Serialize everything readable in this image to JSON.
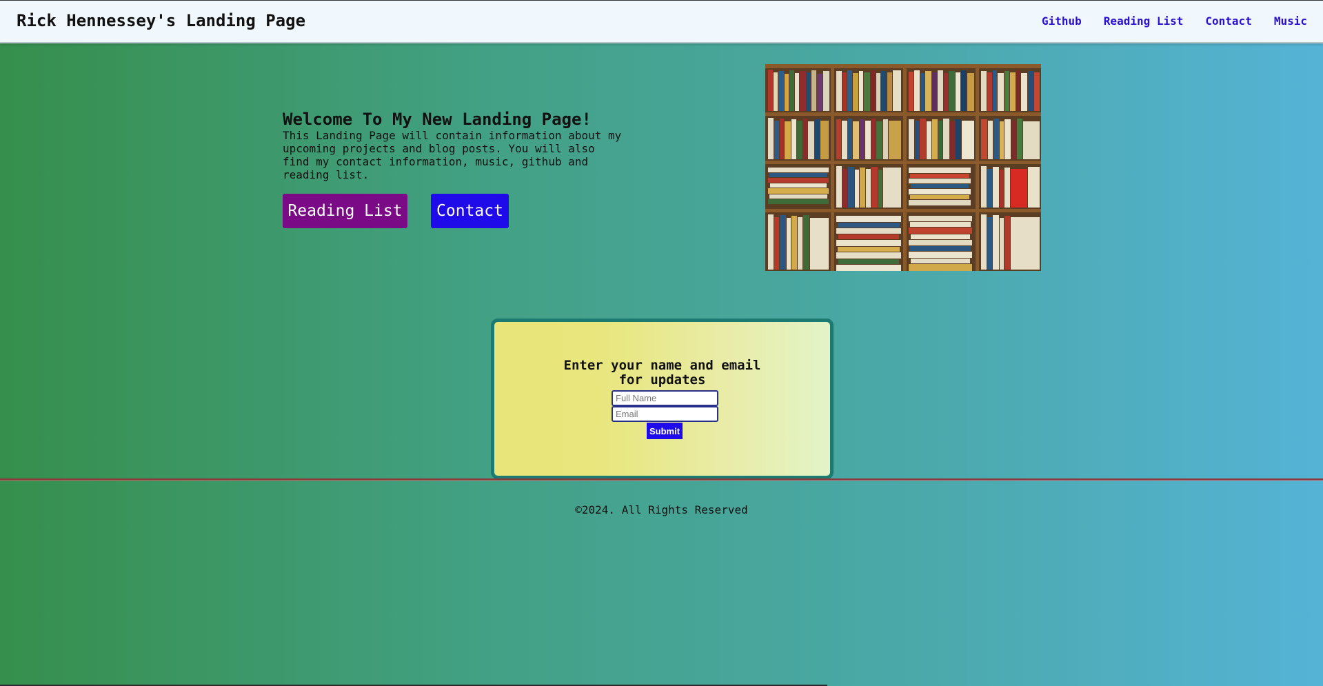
{
  "header": {
    "title": "Rick Hennessey's Landing Page",
    "nav": [
      "Github",
      "Reading List",
      "Contact",
      "Music"
    ]
  },
  "hero": {
    "title": "Welcome To My New Landing Page!",
    "description": "This Landing Page will contain information about my upcoming projects and blog posts. You will also find my contact information, music, github and reading list.",
    "buttons": {
      "reading_list": "Reading List",
      "contact": "Contact"
    },
    "image_icon": "bookshelf-image"
  },
  "signup": {
    "title": "Enter your name and email for updates",
    "name_placeholder": "Full Name",
    "email_placeholder": "Email",
    "submit_label": "Submit"
  },
  "footer": {
    "text": "©2024. All Rights Reserved"
  },
  "colors": {
    "nav_link": "#2a0fd0",
    "reading_button": "#7a0a85",
    "contact_button": "#1f0bea",
    "card_border": "#1c7a70"
  }
}
